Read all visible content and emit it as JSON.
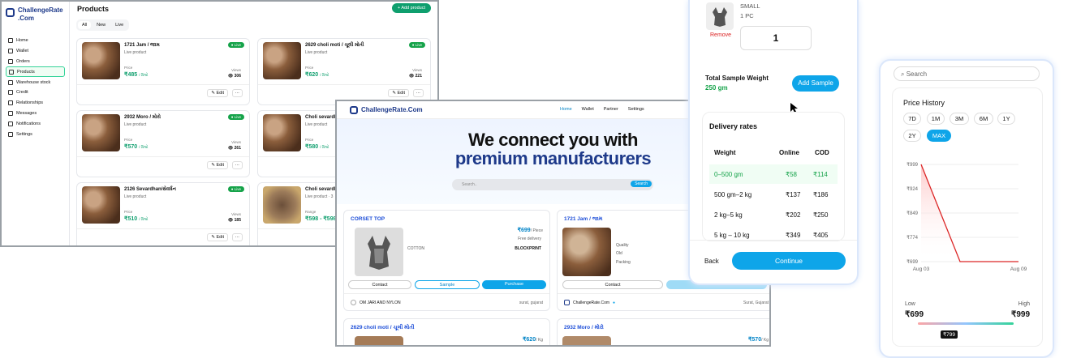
{
  "admin": {
    "brand_line1": "ChallengeRate",
    "brand_line2": ".Com",
    "nav": [
      "Home",
      "Wallet",
      "Orders",
      "Products",
      "Warehouse stock",
      "Credit",
      "Relationships",
      "Messages",
      "Notifications",
      "Settings"
    ],
    "nav_active": "Products",
    "page_title": "Products",
    "add_product": "+ Add product",
    "filters": [
      "All",
      "New",
      "Live"
    ],
    "price_label": "Price",
    "range_label": "Range",
    "views_label": "Views",
    "edit_label": "Edit",
    "more_label": "···",
    "cards": [
      {
        "name": "1721 Jam / જામ",
        "sub": "Live product",
        "badge": "Live",
        "price": "₹485",
        "unit": "/ કિલો",
        "views": "306"
      },
      {
        "name": "2629 choli moti / ચૂલી મોતી",
        "sub": "Live product",
        "badge": "Live",
        "price": "₹620",
        "unit": "/ કિલો",
        "views": "221"
      },
      {
        "name": "2932 Moro / મોરો",
        "sub": "Live product",
        "badge": "Live",
        "price": "₹570",
        "unit": "/ કિલો",
        "views": "261"
      },
      {
        "name": "Choli sevardh",
        "sub": "Live product",
        "badge": "Live",
        "price": "₹580",
        "unit": "/ કિલો",
        "views": ""
      },
      {
        "name": "2126 Sevardhan/સેવર્ધન",
        "sub": "Live product",
        "badge": "Live",
        "price": "₹510",
        "unit": "/ કિલો",
        "views": "185"
      },
      {
        "name": "Choli sevardh",
        "sub": "Live product · 3",
        "badge": "Live",
        "price": "₹598 - ₹598",
        "unit": "",
        "views": ""
      }
    ]
  },
  "market": {
    "brand": "ChallengeRate.Com",
    "nav": [
      "Home",
      "Wallet",
      "Partner",
      "Settings"
    ],
    "headline1": "We connect you with",
    "headline2": "premium manufacturers",
    "search_placeholder": "Search..",
    "search_button": "Search",
    "card1": {
      "title": "CORSET TOP",
      "price": "₹699",
      "unit": "/ Piece",
      "delivery": "Free delivery",
      "material": "COTTON",
      "print": "BLOCKPRINT",
      "contact": "Contact",
      "sample": "Sample",
      "purchase": "Purchase",
      "seller": "OM JARI AND NYLON",
      "location": "surat, gujarat"
    },
    "card2": {
      "title": "1721 Jam / જામ",
      "quality": "Quality",
      "old": "Old",
      "packing": "Packing",
      "contact": "Contact",
      "seller": "ChallengeRate.Com",
      "location": "Surat, Gujarat"
    },
    "card3": {
      "title": "2629 choli moti / ચૂલી મોતી",
      "price": "₹620",
      "unit": "/ Kg"
    },
    "card4": {
      "title": "2932 Moro / મોરો",
      "price": "₹570",
      "unit": "/ Kg"
    }
  },
  "sample": {
    "size": "SMALL",
    "qty_label": "1 PC",
    "remove": "Remove",
    "qty": "1",
    "weight_label": "Total Sample Weight",
    "weight": "250 gm",
    "add_sample": "Add Sample",
    "delivery_title": "Delivery rates",
    "cols": [
      "Weight",
      "Online",
      "COD"
    ],
    "rows": [
      [
        "0–500 gm",
        "₹58",
        "₹114"
      ],
      [
        "500 gm–2 kg",
        "₹137",
        "₹186"
      ],
      [
        "2 kg–5 kg",
        "₹202",
        "₹250"
      ],
      [
        "5 kg – 10 kg",
        "₹349",
        "₹405"
      ]
    ],
    "back": "Back",
    "continue": "Continue"
  },
  "history": {
    "search_placeholder": "Search",
    "title": "Price History",
    "ranges": [
      "7D",
      "1M",
      "3M",
      "6M",
      "1Y",
      "2Y",
      "MAX"
    ],
    "range_active": "MAX",
    "low_label": "Low",
    "high_label": "High",
    "low": "₹699",
    "high": "₹999",
    "current": "₹799"
  },
  "chart_data": {
    "type": "line",
    "x": [
      "Aug 03",
      "Aug 09"
    ],
    "y_ticks": [
      "₹999",
      "₹924",
      "₹849",
      "₹774",
      "₹699"
    ],
    "ylim": [
      699,
      999
    ],
    "series": [
      {
        "points": [
          [
            0,
            999
          ],
          [
            0.4,
            699
          ],
          [
            1,
            699
          ]
        ]
      }
    ]
  }
}
